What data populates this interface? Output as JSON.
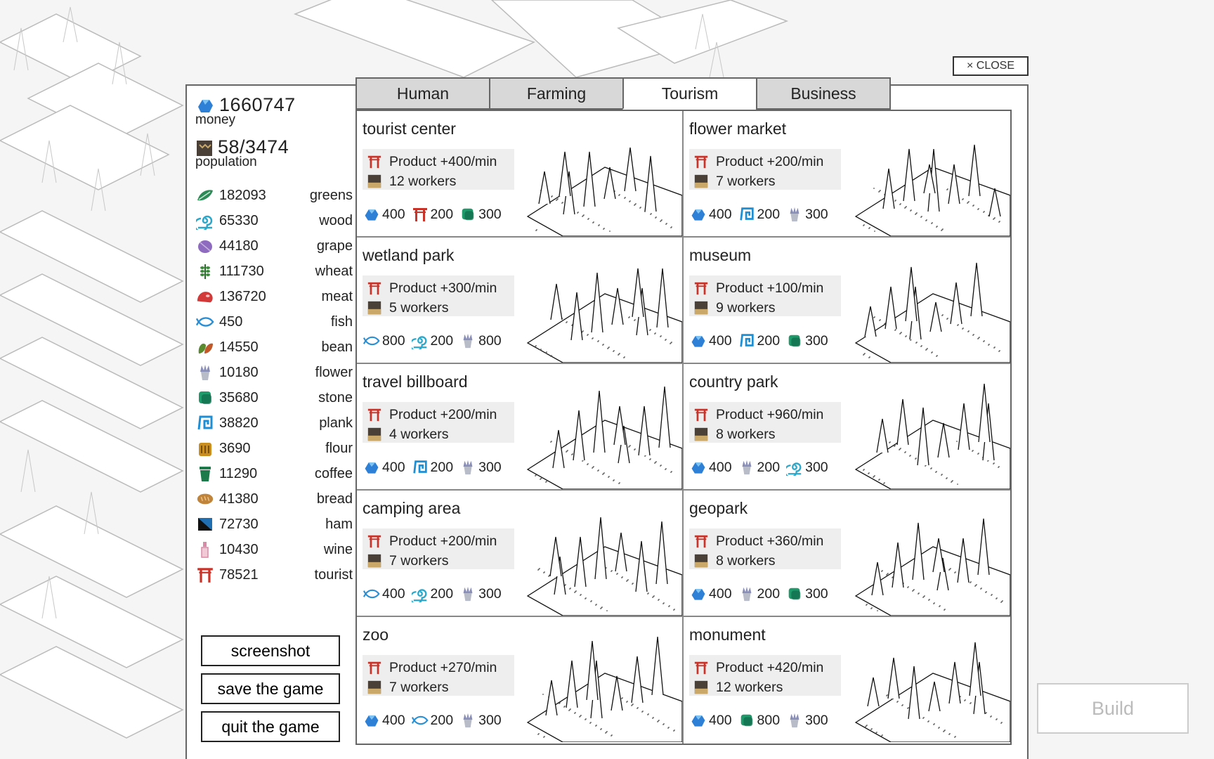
{
  "close_label": "× CLOSE",
  "build_label": "Build",
  "summary": {
    "money": "1660747",
    "money_label": "money",
    "population": "58/3474",
    "population_label": "population"
  },
  "resources": [
    {
      "icon": "greens-icon",
      "value": "182093",
      "name": "greens",
      "color": "#2e8b57"
    },
    {
      "icon": "wood-icon",
      "value": "65330",
      "name": "wood",
      "color": "#2aa7c9"
    },
    {
      "icon": "grape-icon",
      "value": "44180",
      "name": "grape",
      "color": "#8e6bbf"
    },
    {
      "icon": "wheat-icon",
      "value": "111730",
      "name": "wheat",
      "color": "#3d8b3d"
    },
    {
      "icon": "meat-icon",
      "value": "136720",
      "name": "meat",
      "color": "#d23a3a"
    },
    {
      "icon": "fish-icon",
      "value": "450",
      "name": "fish",
      "color": "#2a8fd4"
    },
    {
      "icon": "bean-icon",
      "value": "14550",
      "name": "bean",
      "color": "#5a8a2e"
    },
    {
      "icon": "flower-icon",
      "value": "10180",
      "name": "flower",
      "color": "#8a8fb8"
    },
    {
      "icon": "stone-icon",
      "value": "35680",
      "name": "stone",
      "color": "#1f9a6a"
    },
    {
      "icon": "plank-icon",
      "value": "38820",
      "name": "plank",
      "color": "#1f8fd4"
    },
    {
      "icon": "flour-icon",
      "value": "3690",
      "name": "flour",
      "color": "#c98e1e"
    },
    {
      "icon": "coffee-icon",
      "value": "11290",
      "name": "coffee",
      "color": "#1e7a4a"
    },
    {
      "icon": "bread-icon",
      "value": "41380",
      "name": "bread",
      "color": "#c0843a"
    },
    {
      "icon": "ham-icon",
      "value": "72730",
      "name": "ham",
      "color": "#1f6fb2"
    },
    {
      "icon": "wine-icon",
      "value": "10430",
      "name": "wine",
      "color": "#d98aa6"
    },
    {
      "icon": "tourist-icon",
      "value": "78521",
      "name": "tourist",
      "color": "#c8342a"
    }
  ],
  "buttons": {
    "screenshot": "screenshot",
    "save": "save the game",
    "quit": "quit the game"
  },
  "tabs": [
    {
      "label": "Human",
      "active": false
    },
    {
      "label": "Farming",
      "active": false
    },
    {
      "label": "Tourism",
      "active": true
    },
    {
      "label": "Business",
      "active": false
    }
  ],
  "buildings": [
    {
      "name": "tourist center",
      "product": "Product +400/min",
      "workers": "12 workers",
      "costs": [
        {
          "icon": "money-icon",
          "value": "400"
        },
        {
          "icon": "tourist-icon",
          "value": "200"
        },
        {
          "icon": "stone-icon",
          "value": "300"
        }
      ]
    },
    {
      "name": "flower market",
      "product": "Product +200/min",
      "workers": "7 workers",
      "costs": [
        {
          "icon": "money-icon",
          "value": "400"
        },
        {
          "icon": "plank-icon",
          "value": "200"
        },
        {
          "icon": "flower-icon",
          "value": "300"
        }
      ]
    },
    {
      "name": "wetland park",
      "product": "Product +300/min",
      "workers": "5 workers",
      "costs": [
        {
          "icon": "fish-icon",
          "value": "800"
        },
        {
          "icon": "wood-icon",
          "value": "200"
        },
        {
          "icon": "flower-icon",
          "value": "800"
        }
      ]
    },
    {
      "name": "museum",
      "product": "Product +100/min",
      "workers": "9 workers",
      "costs": [
        {
          "icon": "money-icon",
          "value": "400"
        },
        {
          "icon": "plank-icon",
          "value": "200"
        },
        {
          "icon": "stone-icon",
          "value": "300"
        }
      ]
    },
    {
      "name": "travel billboard",
      "product": "Product +200/min",
      "workers": "4 workers",
      "costs": [
        {
          "icon": "money-icon",
          "value": "400"
        },
        {
          "icon": "plank-icon",
          "value": "200"
        },
        {
          "icon": "flower-icon",
          "value": "300"
        }
      ]
    },
    {
      "name": "country park",
      "product": "Product +960/min",
      "workers": "8 workers",
      "costs": [
        {
          "icon": "money-icon",
          "value": "400"
        },
        {
          "icon": "flower-icon",
          "value": "200"
        },
        {
          "icon": "wood-icon",
          "value": "300"
        }
      ]
    },
    {
      "name": "camping area",
      "product": "Product +200/min",
      "workers": "7 workers",
      "costs": [
        {
          "icon": "fish-icon",
          "value": "400"
        },
        {
          "icon": "wood-icon",
          "value": "200"
        },
        {
          "icon": "flower-icon",
          "value": "300"
        }
      ]
    },
    {
      "name": "geopark",
      "product": "Product +360/min",
      "workers": "8 workers",
      "costs": [
        {
          "icon": "money-icon",
          "value": "400"
        },
        {
          "icon": "flower-icon",
          "value": "200"
        },
        {
          "icon": "stone-icon",
          "value": "300"
        }
      ]
    },
    {
      "name": "zoo",
      "product": "Product +270/min",
      "workers": "7 workers",
      "costs": [
        {
          "icon": "money-icon",
          "value": "400"
        },
        {
          "icon": "fish-icon",
          "value": "200"
        },
        {
          "icon": "flower-icon",
          "value": "300"
        }
      ]
    },
    {
      "name": "monument",
      "product": "Product +420/min",
      "workers": "12 workers",
      "costs": [
        {
          "icon": "money-icon",
          "value": "400"
        },
        {
          "icon": "stone-icon",
          "value": "800"
        },
        {
          "icon": "flower-icon",
          "value": "300"
        }
      ]
    }
  ]
}
